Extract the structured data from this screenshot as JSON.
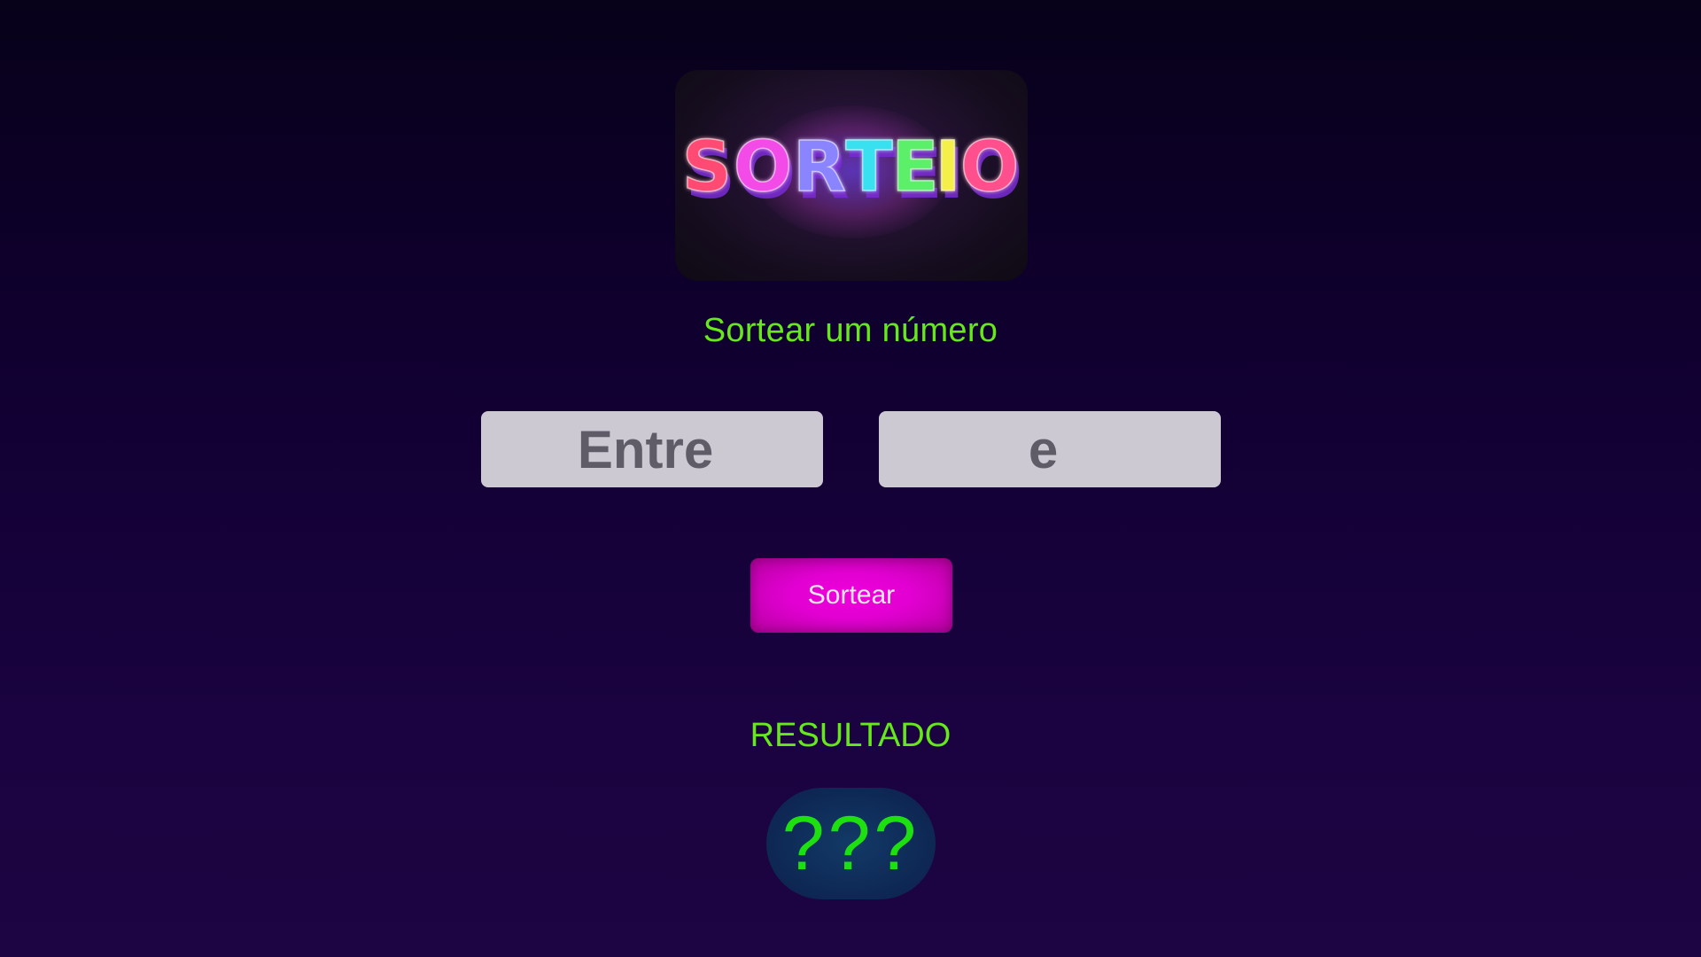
{
  "logo": {
    "text": "SORTEIO",
    "letters": [
      "S",
      "O",
      "R",
      "T",
      "E",
      "I",
      "O"
    ],
    "letter_colors": [
      "#ff4b73",
      "#f24ce8",
      "#8a84ff",
      "#38e0f0",
      "#5cf06a",
      "#f4f04a",
      "#ff4f8c"
    ],
    "shadow_color": "#7a2bd6"
  },
  "header": {
    "subtitle": "Sortear um número"
  },
  "form": {
    "min_input": {
      "placeholder": "Entre",
      "value": ""
    },
    "max_input": {
      "placeholder": "e",
      "value": ""
    },
    "draw_button_label": "Sortear"
  },
  "result": {
    "label": "RESULTADO",
    "value": "???"
  },
  "colors": {
    "accent_green": "#66e81a",
    "result_green": "#1ee010",
    "button_magenta": "#e000d0",
    "input_bg": "#cdc9d3"
  }
}
